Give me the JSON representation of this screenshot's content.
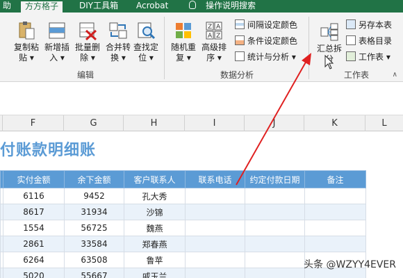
{
  "tabs": [
    {
      "label": "助"
    },
    {
      "label": "方方格子"
    },
    {
      "label": "DIY工具箱"
    },
    {
      "label": "Acrobat"
    },
    {
      "label": "操作说明搜索"
    }
  ],
  "ribbon": {
    "edit_group": {
      "label": "编辑",
      "buttons": [
        {
          "line1": "复制粘",
          "line2": "贴 ▾"
        },
        {
          "line1": "新增插",
          "line2": "入 ▾"
        },
        {
          "line1": "批量删",
          "line2": "除 ▾"
        },
        {
          "line1": "合并转",
          "line2": "换 ▾"
        },
        {
          "line1": "查找定",
          "line2": "位 ▾"
        }
      ]
    },
    "analysis_group": {
      "label": "数据分析",
      "buttons": [
        {
          "line1": "随机重",
          "line2": "复 ▾"
        },
        {
          "line1": "高级排",
          "line2": "序 ▾"
        }
      ],
      "small_buttons": [
        {
          "label": "间隔设定颜色"
        },
        {
          "label": "条件设定颜色"
        },
        {
          "label": "统计与分析 ▾"
        }
      ]
    },
    "sheet_group": {
      "label": "工作表",
      "big_button": {
        "line1": "汇总拆",
        "line2": "分"
      },
      "small_buttons": [
        {
          "label": "另存本表"
        },
        {
          "label": "表格目录"
        },
        {
          "label": "工作表 ▾"
        }
      ]
    }
  },
  "columns": [
    "F",
    "G",
    "H",
    "I",
    "J",
    "K",
    "L"
  ],
  "sheet": {
    "title": "付账款明细账",
    "headers": [
      "实付金额",
      "余下金额",
      "客户联系人",
      "联系电话",
      "约定付款日期",
      "备注"
    ],
    "rows": [
      [
        "6116",
        "9452",
        "孔大秀",
        "",
        "",
        ""
      ],
      [
        "8617",
        "31934",
        "沙锦",
        "",
        "",
        ""
      ],
      [
        "1554",
        "56725",
        "魏燕",
        "",
        "",
        ""
      ],
      [
        "2861",
        "33584",
        "郑春燕",
        "",
        "",
        ""
      ],
      [
        "6264",
        "63508",
        "鲁苹",
        "",
        "",
        ""
      ],
      [
        "5020",
        "55667",
        "戚玉兰",
        "",
        "",
        ""
      ]
    ]
  },
  "watermark": "头条 @WZYY4EVER",
  "colors": {
    "accent": "#217346",
    "header_blue": "#5b9bd5",
    "arrow_red": "#e02020"
  }
}
